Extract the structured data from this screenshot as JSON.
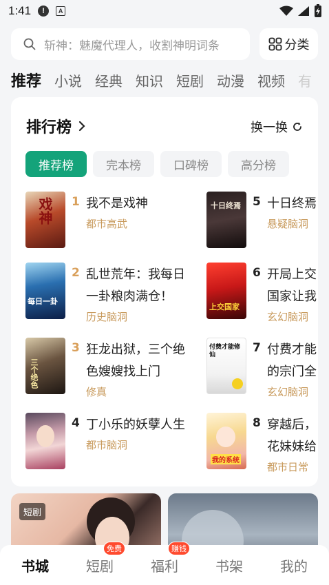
{
  "status_bar": {
    "time": "1:41"
  },
  "search": {
    "placeholder": "斩神：魅魔代理人，收割神明词条"
  },
  "category_button": {
    "label": "分类"
  },
  "tabs": [
    {
      "label": "推荐"
    },
    {
      "label": "小说"
    },
    {
      "label": "经典"
    },
    {
      "label": "知识"
    },
    {
      "label": "短剧"
    },
    {
      "label": "动漫"
    },
    {
      "label": "视频"
    },
    {
      "label": "有"
    }
  ],
  "ranking": {
    "title": "排行榜",
    "refresh_label": "换一换",
    "filters": [
      {
        "label": "推荐榜"
      },
      {
        "label": "完本榜"
      },
      {
        "label": "口碑榜"
      },
      {
        "label": "高分榜"
      }
    ],
    "books": [
      {
        "rank": "1",
        "title_lines": [
          "我不是戏神"
        ],
        "genre": "都市高武",
        "cover_text": "戏神"
      },
      {
        "rank": "2",
        "title_lines": [
          "乱世荒年：我每日",
          "一卦粮肉满仓！"
        ],
        "genre": "历史脑洞",
        "cover_text": "每日一卦"
      },
      {
        "rank": "3",
        "title_lines": [
          "狂龙出狱，三个绝",
          "色嫂嫂找上门"
        ],
        "genre": "修真",
        "cover_text": "三个绝色"
      },
      {
        "rank": "4",
        "title_lines": [
          "丁小乐的妖孽人生"
        ],
        "genre": "都市脑洞",
        "cover_text": ""
      },
      {
        "rank": "5",
        "title_lines": [
          "十日终焉"
        ],
        "genre": "悬疑脑洞",
        "cover_text": "十日终焉"
      },
      {
        "rank": "6",
        "title_lines": [
          "开局上交",
          "国家让我"
        ],
        "genre": "玄幻脑洞",
        "cover_text": "上交国家"
      },
      {
        "rank": "7",
        "title_lines": [
          "付费才能",
          "的宗门全"
        ],
        "genre": "玄幻脑洞",
        "cover_text": "付费才能修仙"
      },
      {
        "rank": "8",
        "title_lines": [
          "穿越后，",
          "花妹妹给"
        ],
        "genre": "都市日常",
        "cover_text": "我的系统"
      }
    ]
  },
  "short_drama": {
    "badge": "短剧"
  },
  "bottom_nav": {
    "items": [
      {
        "label": "书城",
        "badge": ""
      },
      {
        "label": "短剧",
        "badge": "免费"
      },
      {
        "label": "福利",
        "badge": "赚钱"
      },
      {
        "label": "书架",
        "badge": ""
      },
      {
        "label": "我的",
        "badge": ""
      }
    ]
  },
  "colors": {
    "accent_green": "#14a37a",
    "rank_top_gold": "#d9a05b",
    "genre_tan": "#c89a5c",
    "badge_red": "#ff4a2e"
  }
}
